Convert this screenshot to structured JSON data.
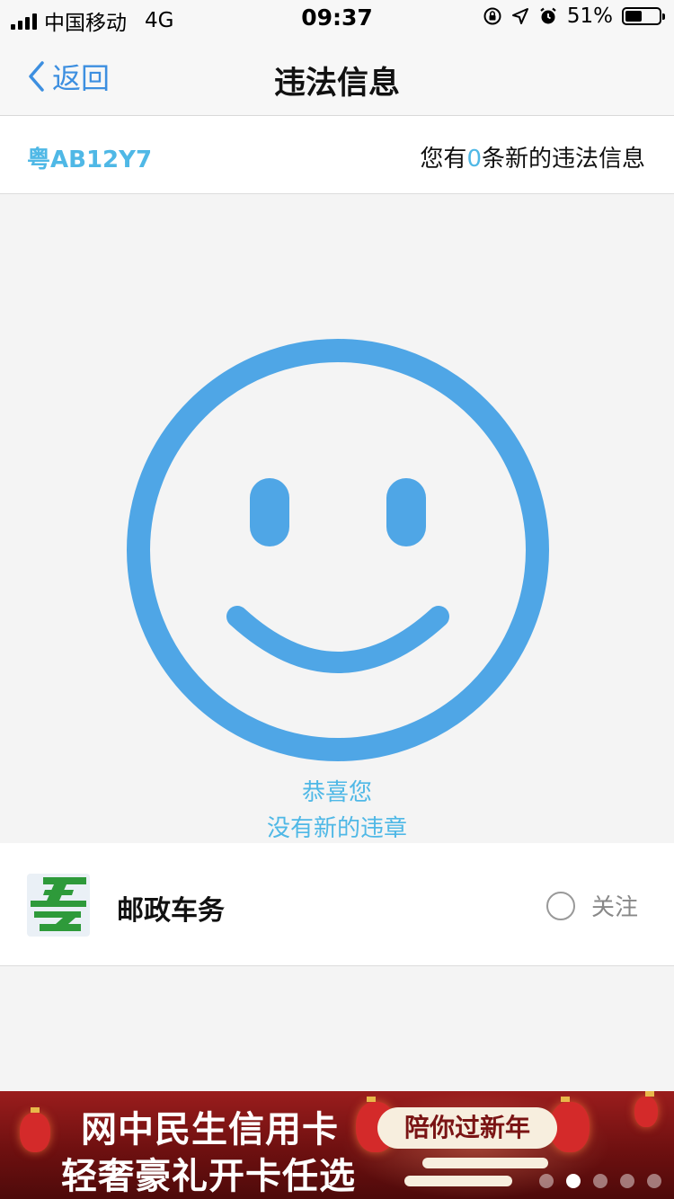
{
  "status_bar": {
    "carrier": "中国移动",
    "network": "4G",
    "time": "09:37",
    "battery_text": "51%",
    "battery_level": 0.51,
    "icons": [
      "orientation-lock-icon",
      "location-arrow-icon",
      "alarm-icon"
    ]
  },
  "nav": {
    "back_label": "返回",
    "title": "违法信息"
  },
  "plate_bar": {
    "plate": "粤AB12Y7",
    "msg_prefix": "您有",
    "msg_count": "0",
    "msg_suffix": "条新的违法信息"
  },
  "hero": {
    "line1": "恭喜您",
    "line2": "没有新的违章",
    "icon": "smiley-face-icon"
  },
  "service_card": {
    "name": "邮政车务",
    "follow_label": "关注",
    "logo_icon": "china-post-logo"
  },
  "banner": {
    "line1": "网中民生信用卡",
    "line2": "轻奢豪礼开卡任选",
    "tag": "陪你过新年",
    "page_count": 5,
    "active_page": 1
  },
  "colors": {
    "accent": "#3d8fe0",
    "plate_blue": "#4fb8e6",
    "smiley_blue": "#4fa6e6",
    "post_green": "#2e9a3a",
    "banner_red": "#7a1414"
  }
}
